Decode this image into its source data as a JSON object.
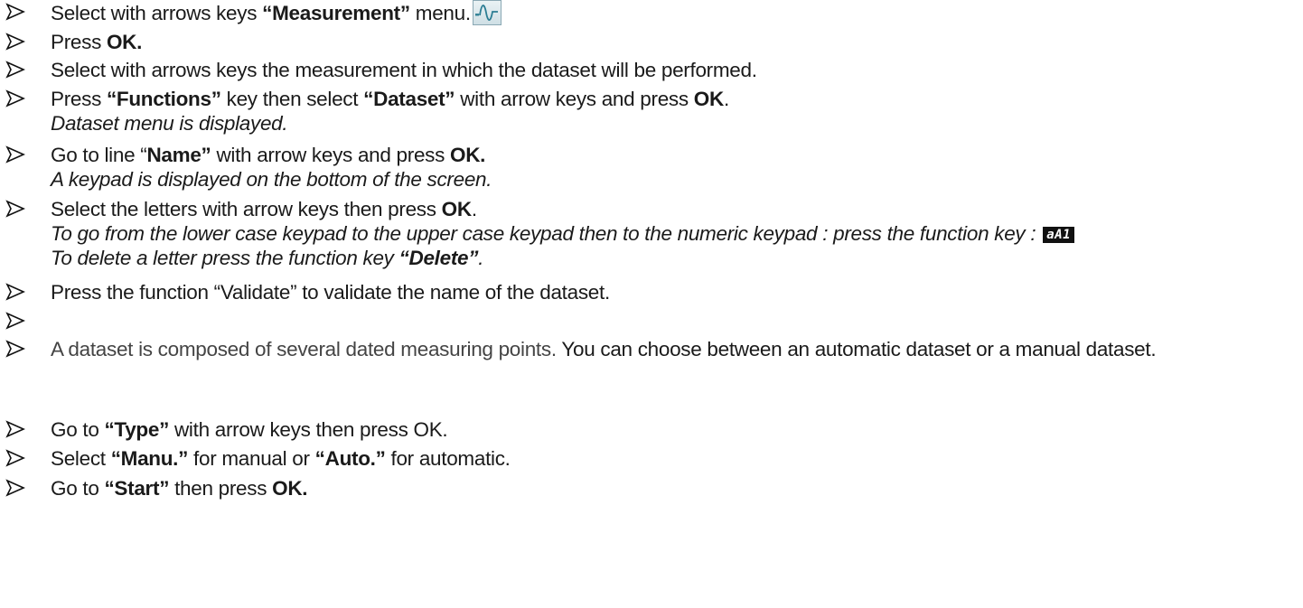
{
  "steps": [
    {
      "pre": "Select with arrows keys ",
      "bold": "“Measurement”",
      "post": " menu.",
      "icon": "measurement-wave-icon"
    },
    {
      "pre": "Press ",
      "bold": "OK."
    },
    {
      "text": "Select with arrows keys the measurement in which the dataset will be performed."
    },
    {
      "pre": "Press ",
      "bold": "“Functions”",
      "mid": " key then select ",
      "bold2": "“Dataset”",
      "post": " with arrow keys and press ",
      "bold3": "OK",
      "tail": ".",
      "note": "Dataset menu is displayed."
    },
    {
      "pre": "Go to line “",
      "bold": "Name”",
      "post": " with arrow keys and press ",
      "bold2": "OK.",
      "note": "A keypad is displayed on the bottom of the screen."
    },
    {
      "pre": "Select the letters with arrow keys then press ",
      "bold": "OK",
      "post": ".",
      "note1": "To go from the lower case keypad to the upper case keypad then to the numeric keypad : press the function key :",
      "key_badge": "aA1",
      "note2_pre": "To delete a letter press the function key ",
      "note2_bold": "“Delete”",
      "note2_post": "."
    },
    {
      "text": "Press the function “Validate” to validate the name of the dataset."
    },
    {
      "text": ""
    },
    {
      "pre": "A dataset is composed of several dated measuring points. ",
      "post": "You can choose between an automatic dataset or a manual dataset."
    },
    {
      "pre": "Go to ",
      "bold": "“Type”",
      "post": " with arrow keys then press OK."
    },
    {
      "pre": "Select ",
      "bold": "“Manu.”",
      "mid": " for manual or ",
      "bold2": "“Auto.”",
      "post": " for automatic."
    },
    {
      "pre": "Go to ",
      "bold": "“Start”",
      "post": " then press ",
      "bold2": "OK."
    }
  ]
}
